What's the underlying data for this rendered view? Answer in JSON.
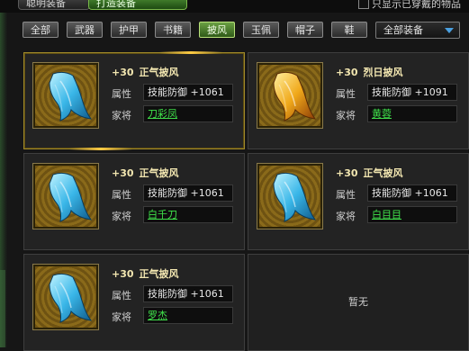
{
  "top_tabs": [
    "聪明装备",
    "打造装备"
  ],
  "hide_option": "只显示已穿戴的物品",
  "filter_tabs": [
    {
      "label": "全部",
      "active": false
    },
    {
      "label": "武器",
      "active": false
    },
    {
      "label": "护甲",
      "active": false
    },
    {
      "label": "书籍",
      "active": false
    },
    {
      "label": "披风",
      "active": true
    },
    {
      "label": "玉佩",
      "active": false
    },
    {
      "label": "帽子",
      "active": false
    },
    {
      "label": "鞋",
      "active": false
    }
  ],
  "dropdown": {
    "selected": "全部装备"
  },
  "items": [
    {
      "level": "+30",
      "name": "正气披风",
      "attr_label": "属性",
      "attr_value": "技能防御 +1061",
      "general_label": "家将",
      "general": "刀彩凤",
      "selected": true,
      "color": "blue"
    },
    {
      "level": "+30",
      "name": "烈日披风",
      "attr_label": "属性",
      "attr_value": "技能防御 +1091",
      "general_label": "家将",
      "general": "黄蓉",
      "selected": false,
      "color": "gold"
    },
    {
      "level": "+30",
      "name": "正气披风",
      "attr_label": "属性",
      "attr_value": "技能防御 +1061",
      "general_label": "家将",
      "general": "白千刀",
      "selected": false,
      "color": "blue"
    },
    {
      "level": "+30",
      "name": "正气披风",
      "attr_label": "属性",
      "attr_value": "技能防御 +1061",
      "general_label": "家将",
      "general": "白目目",
      "selected": false,
      "color": "blue"
    },
    {
      "level": "+30",
      "name": "正气披风",
      "attr_label": "属性",
      "attr_value": "技能防御 +1061",
      "general_label": "家将",
      "general": "罗杰",
      "selected": false,
      "color": "blue"
    }
  ],
  "empty_slot": "暂无",
  "colors": {
    "link": "#3fe04a",
    "title": "#f2e6b0",
    "active_tab": "#6aa043",
    "selected_border": "#a08a2a"
  }
}
